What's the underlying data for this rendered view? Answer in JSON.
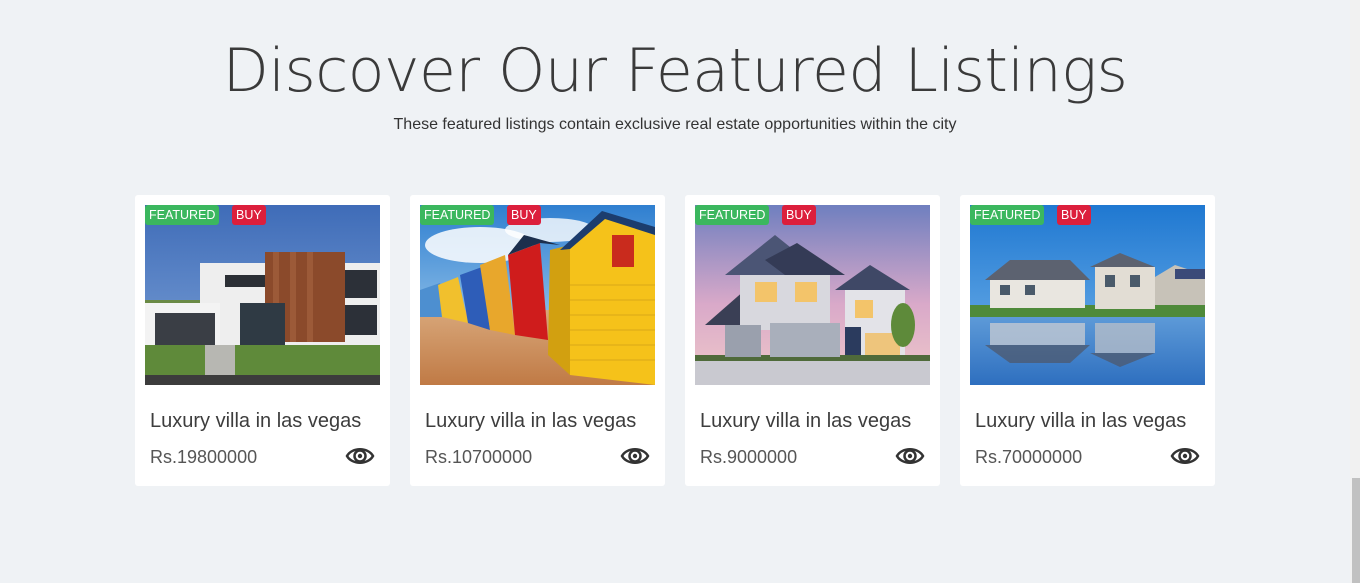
{
  "section": {
    "title": "Discover Our Featured Listings",
    "subtitle": "These featured listings contain exclusive real estate opportunities within the city"
  },
  "listings": [
    {
      "title": "Luxury villa in las vegas",
      "price": "Rs.19800000",
      "badge_featured": "FEATURED",
      "badge_type": "BUY"
    },
    {
      "title": "Luxury villa in las vegas",
      "price": "Rs.10700000",
      "badge_featured": "FEATURED",
      "badge_type": "BUY"
    },
    {
      "title": "Luxury villa in las vegas",
      "price": "Rs.9000000",
      "badge_featured": "FEATURED",
      "badge_type": "BUY"
    },
    {
      "title": "Luxury villa in las vegas",
      "price": "Rs.70000000",
      "badge_featured": "FEATURED",
      "badge_type": "BUY"
    }
  ],
  "icons": {
    "view": "eye-icon"
  },
  "colors": {
    "featured": "#3bb75e",
    "buy": "#dc1f3c",
    "background": "#eff2f5"
  }
}
